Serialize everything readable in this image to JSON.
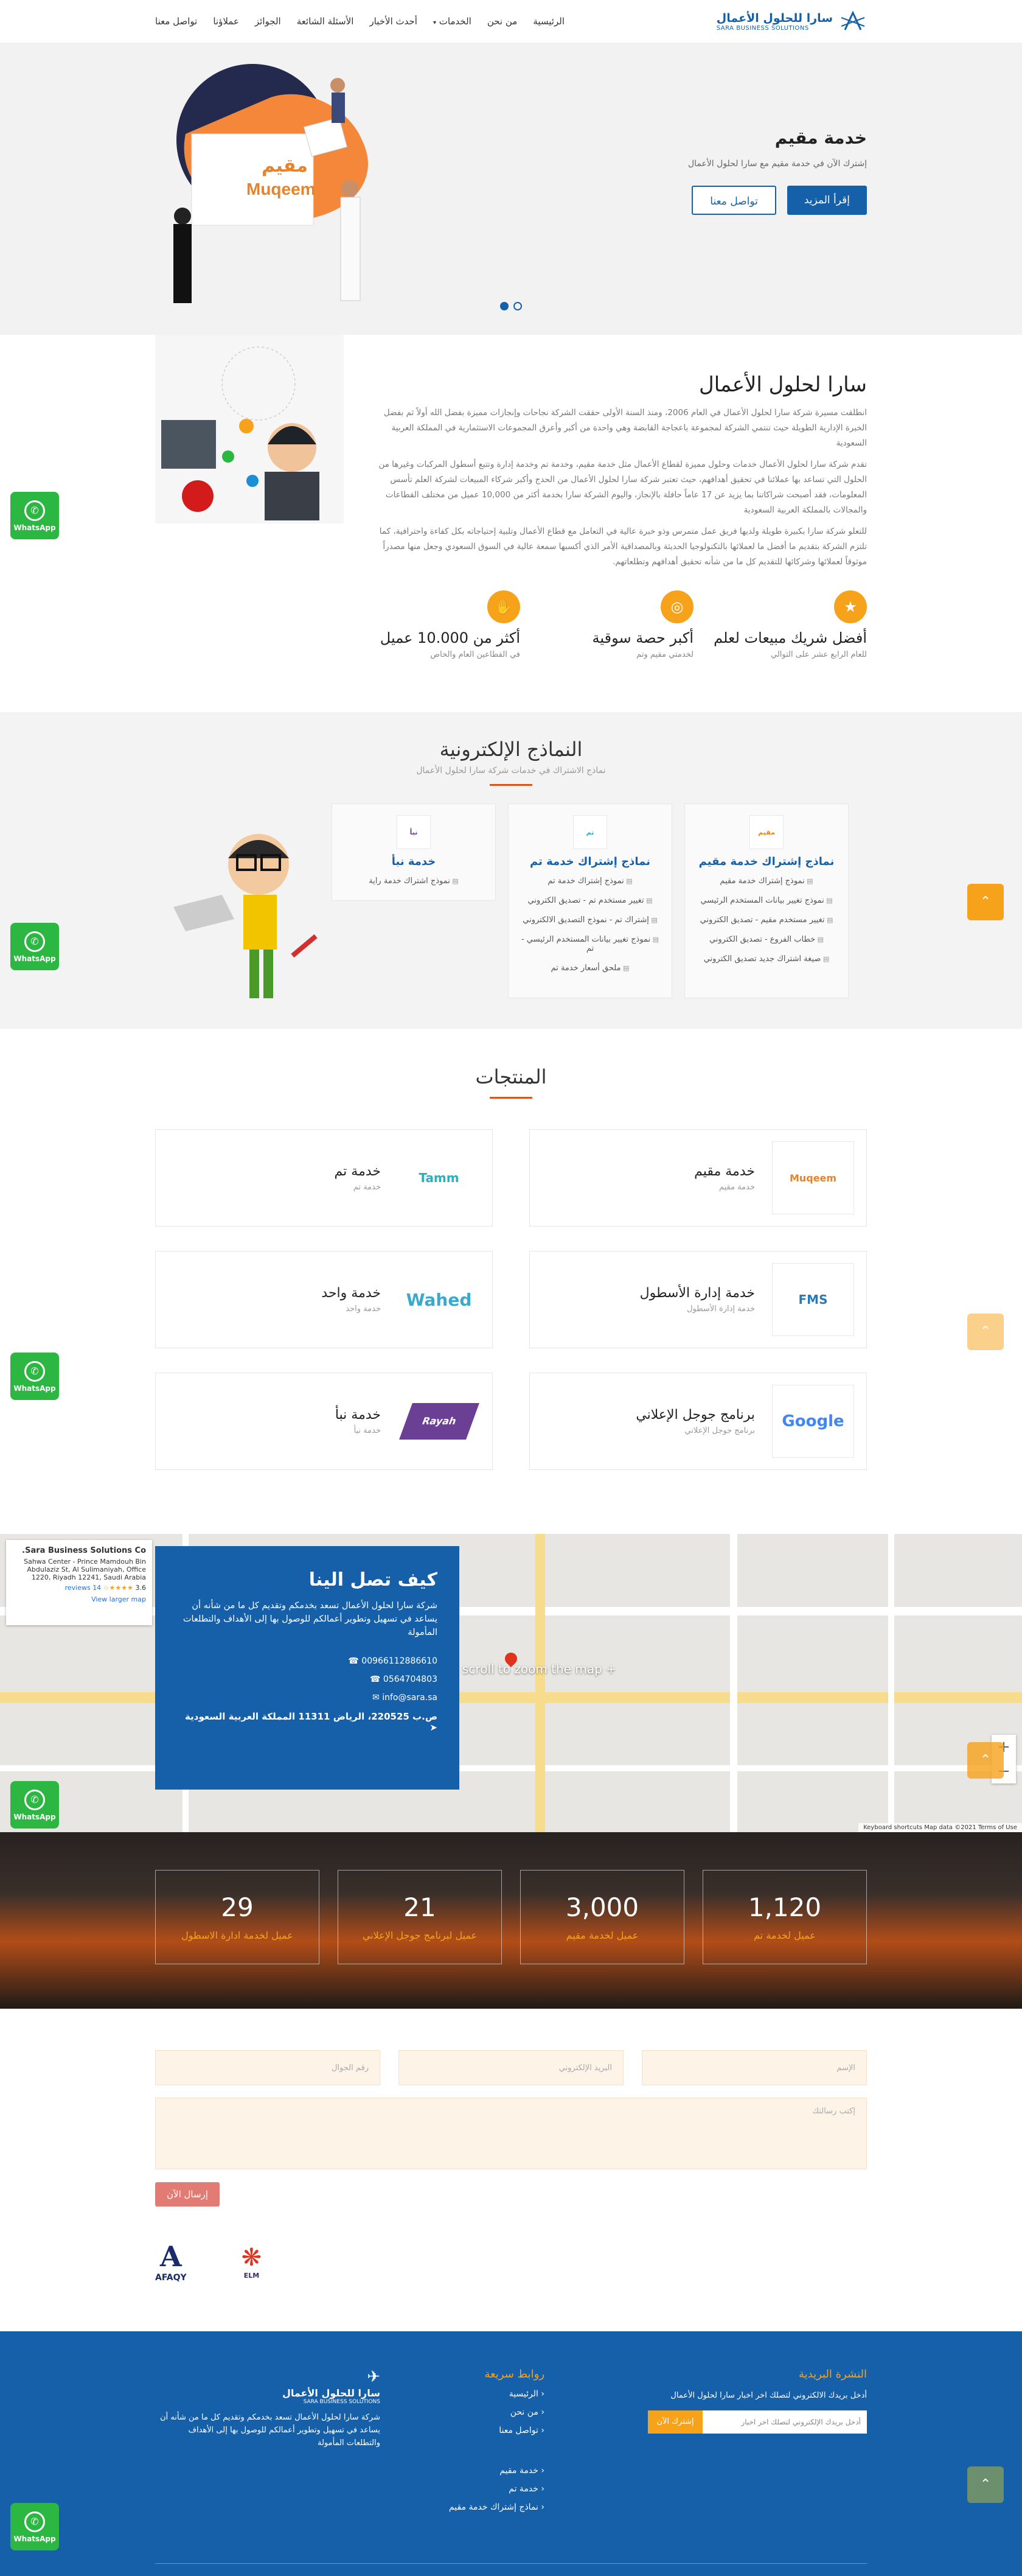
{
  "header": {
    "logo_ar": "سارا للحلول الأعمال",
    "logo_en": "SARA BUSINESS SOLUTIONS",
    "nav": [
      "الرئيسية",
      "من نحن",
      "الخدمات",
      "أحدث الأخبار",
      "الأسئلة الشائعة",
      "الجوائز",
      "عملاؤنا",
      "تواصل معنا"
    ]
  },
  "hero": {
    "title": "خدمة مقيم",
    "subtitle": "إشترك الآن في خدمة مقيم مع سارا لحلول الأعمال",
    "read_more": "إقرأ المزيد",
    "contact": "تواصل معنا",
    "board_ar": "مقيم",
    "board_en": "Muqeem"
  },
  "about": {
    "title": "سارا لحلول الأعمال",
    "p1": "انطلقت مسيرة شركة سارا لحلول الأعمال في العام 2006، ومنذ السنة الأولى حققت الشركة نجاحات وإنجازات مميزة بفضل الله أولاً ثم بفضل الخبرة الإدارية الطويلة حيث تنتمي الشركة لمجموعة باعجاجة القابضة وهي واحدة من أكبر وأعرق المجموعات الاستثمارية في المملكة العربية السعودية",
    "p2": "تقدم شركة سارا لحلول الأعمال خدمات وحلول مميزة لقطاع الأعمال مثل خدمة مقيم، وخدمة تم وخدمة إدارة وتتبع أسطول المركبات وغيرها من الحلول التي تساعد بها عملائنا في تحقيق أهدافهم، حيث تعتبر شركة سارا لحلول الأعمال من الحدج وأكبر شركاء المبيعات لشركة العلم تأسس المعلومات، فقد أصبحت شراكاتنا بما يزيد عن 17 عاماً حافلة بالإنجاز، واليوم الشركة سارا بخدمة أكثر من 10,000 عميل من مختلف القطاعات والمجالات بالمملكة العربية السعودية",
    "p3": "للتعلو شركة سارا بكبيرة طويلة ولديها فريق عمل متمرس وذو خبرة عالية في التعامل مع قطاع الأعمال وتلبية إحتياجاته بكل كفاءة واحترافية، كما تلتزم الشركة بتقديم ما أفضل ما لعملائها بالتكنولوجيا الحديثة وبالمصداقية الأمر الذي أكسبها سمعة عالية في السوق السعودي وجعل منها مصدراً موثوقاً لعملائها وشركائها للتقديم كل ما من شأنه تحقيق أهدافهم وتطلعاتهم.",
    "features": [
      {
        "title": "أفضل شريك مبيعات لعلم",
        "desc": "للعام الرابع عشر على التوالي",
        "icon": "award-icon"
      },
      {
        "title": "أكبر حصة سوقية",
        "desc": "لخدمتي مقيم وتم",
        "icon": "target-icon"
      },
      {
        "title": "أكثر من 10.000 عميل",
        "desc": "في القطاعين العام والخاص",
        "icon": "handshake-icon"
      }
    ]
  },
  "forms": {
    "title": "النماذج الإلكترونية",
    "subtitle": "نماذج الاشتراك في خدمات شركة سارا لحلول الأعمال",
    "cards": [
      {
        "title": "نماذج إشتراك خدمة مقيم",
        "thumb": "مقيم",
        "items": [
          "نموذج إشتراك خدمة مقيم",
          "نموذج تغيير بيانات المستخدم الرئيسي",
          "تغيير مستخدم مقيم - تصديق الكتروني",
          "خطاب الفروع - تصديق الكتروني",
          "صيغة اشتراك جديد تصديق الكتروني"
        ]
      },
      {
        "title": "نماذج إشتراك خدمة تم",
        "thumb": "تم",
        "items": [
          "نموذج إشتراك خدمة تم",
          "تغيير مستخدم تم - تصديق الكتروني",
          "إشتراك تم - نموذج التصديق الالكتروني",
          "نموذج تغيير بيانات المستخدم الرئيسي - تم",
          "ملحق أسعار خدمة تم"
        ]
      },
      {
        "title": "خدمة نبأ",
        "thumb": "نبأ",
        "items": [
          "نموذج اشتراك خدمة راية"
        ]
      }
    ]
  },
  "products": {
    "title": "المنتجات",
    "items": [
      {
        "title": "خدمة مقيم",
        "sub": "خدمة مقيم",
        "logo": "Muqeem",
        "color": "#e7832b"
      },
      {
        "title": "خدمة تم",
        "sub": "خدمة تم",
        "logo": "Tamm",
        "color": "#2bb0c0"
      },
      {
        "title": "خدمة إدارة الأسطول",
        "sub": "خدمة إدارة الأسطول",
        "logo": "FMS",
        "color": "#2a7ab8"
      },
      {
        "title": "خدمة واحد",
        "sub": "خدمة واحد",
        "logo": "Wahed",
        "color": "#3aa9cc"
      },
      {
        "title": "برنامج جوجل الإعلاني",
        "sub": "برنامج جوجل الإعلاني",
        "logo": "Google",
        "color": "#4285f4"
      },
      {
        "title": "خدمة نبأ",
        "sub": "خدمة نبأ",
        "logo": "Rayah",
        "color": "#6b3f93"
      }
    ]
  },
  "contact": {
    "title": "كيف تصل الينا",
    "desc": "شركة سارا لحلول الأعمال تسعد بخدمكم وتقديم كل ما من شأنه أن يساعد في تسهيل وتطوير أعمالكم للوصول بها إلى الأهداف والتطلعات المأمولة",
    "phone1": "00966112886610",
    "phone2": "0564704803",
    "email": "info@sara.sa",
    "address": "ص.ب 220525، الرياض 11311 المملكة العربية السعودية",
    "map_name": "Sara Business Solutions Co.",
    "map_addr": "Sahwa Center - Prince Mamdouh Bin Abdulaziz St, Al Sulimaniyah, Office 1220, Riyadh 12241, Saudi Arabia",
    "map_rating": "3.6",
    "map_reviews": "14 reviews",
    "map_link": "View larger map",
    "zoom_hint": "+ scroll to zoom the map",
    "map_footer": "Keyboard shortcuts  Map data ©2021  Terms of Use"
  },
  "stats": [
    {
      "n": "1,120",
      "l": "عميل لخدمة تم"
    },
    {
      "n": "3,000",
      "l": "عميل لخدمة مقيم"
    },
    {
      "n": "21",
      "l": "عميل لبرنامج جوجل الإعلاني"
    },
    {
      "n": "29",
      "l": "عميل لخدمة ادارة الاسطول"
    }
  ],
  "form": {
    "name": "الإسم",
    "email": "البريد الإلكتروني",
    "phone": "رقم الجوال",
    "message": "إكتب رسالتك",
    "send": "إرسال الآن",
    "partner1": "ELM",
    "partner2": "AFAQY"
  },
  "footer": {
    "newsletter_title": "النشرة البريدية",
    "newsletter_desc": "أدخل بريدك الالكتروني لتصلك اخر اخبار سارا لحلول الأعمال",
    "newsletter_placeholder": "أدخل بريدك الإلكتروني لتصلك اخر اخبار",
    "newsletter_btn": "إشترك الآن",
    "links_title": "روابط سريعة",
    "links": [
      "الرئيسية",
      "من نحن",
      "تواصل معنا"
    ],
    "links2": [
      "خدمة مقيم",
      "خدمة تم",
      "نماذج إشتراك خدمة مقيم"
    ],
    "logo_ar": "سارا للحلول الأعمال",
    "logo_en": "SARA BUSINESS SOLUTIONS",
    "about": "شركة سارا لحلول الأعمال تسعد بخدمكم وتقديم كل ما من شأنه أن يساعد في تسهيل وتطوير أعمالكم للوصول بها إلى الأهداف والتطلعات المأمولة"
  },
  "whatsapp": "WhatsApp"
}
